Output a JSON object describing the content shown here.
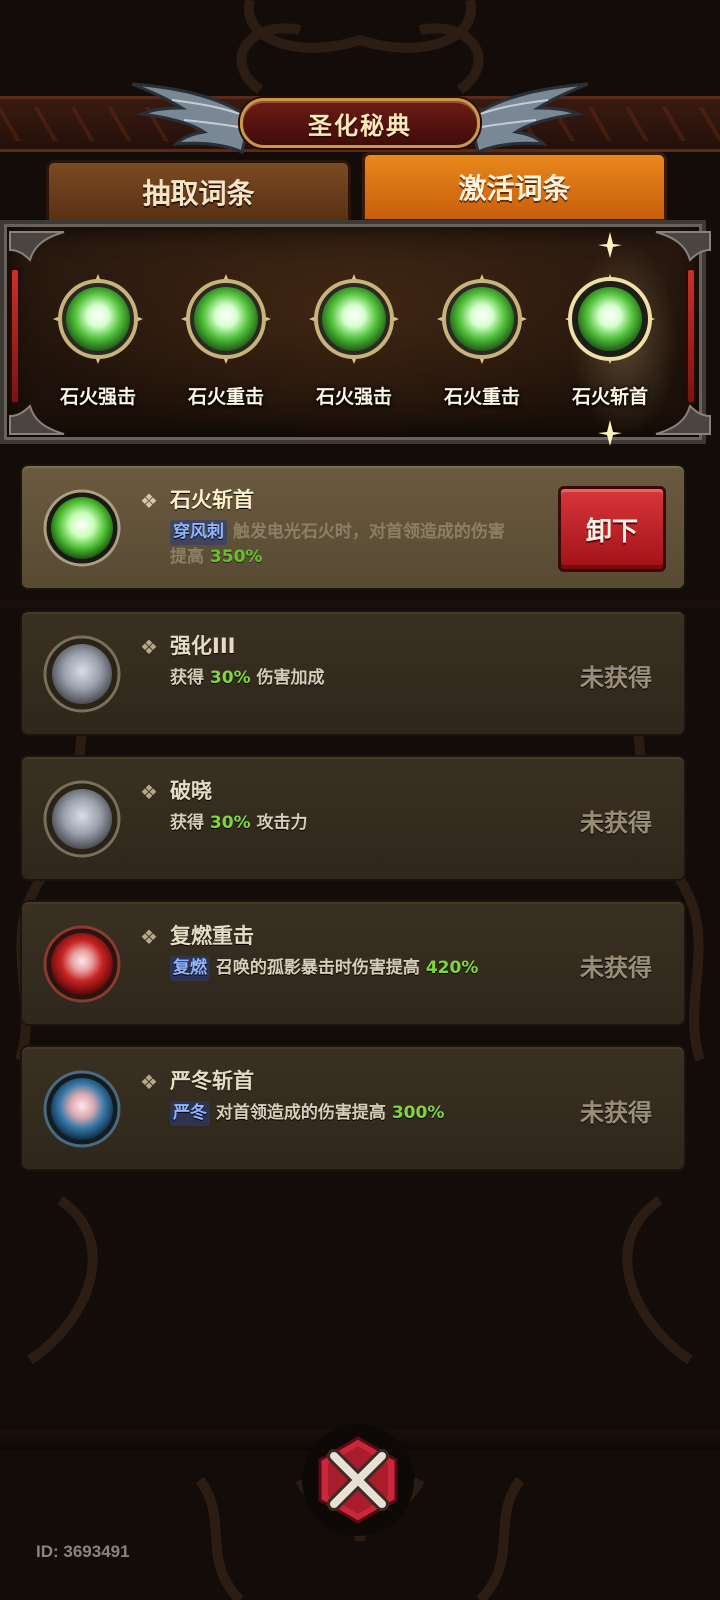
{
  "header": {
    "title": "圣化秘典"
  },
  "tabs": [
    {
      "label": "抽取词条",
      "active": false
    },
    {
      "label": "激活词条",
      "active": true
    }
  ],
  "equipped_slots": [
    {
      "label": "石火强击",
      "orb_color": "green",
      "selected": false
    },
    {
      "label": "石火重击",
      "orb_color": "green",
      "selected": false
    },
    {
      "label": "石火强击",
      "orb_color": "green",
      "selected": false
    },
    {
      "label": "石火重击",
      "orb_color": "green",
      "selected": false
    },
    {
      "label": "石火斩首",
      "orb_color": "green",
      "selected": true
    }
  ],
  "entries": [
    {
      "name": "石火斩首",
      "tag": "穿风刺",
      "desc_before": "触发电光石火时，对首领造成的伤害提高",
      "pct": "350%",
      "desc_after": "",
      "orb_color": "green",
      "active": true,
      "action_label": "卸下"
    },
    {
      "name": "强化III",
      "tag": "",
      "desc_before": "获得",
      "pct": "30%",
      "desc_after": "伤害加成",
      "orb_color": "grey",
      "active": false,
      "status": "未获得"
    },
    {
      "name": "破晓",
      "tag": "",
      "desc_before": "获得",
      "pct": "30%",
      "desc_after": "攻击力",
      "orb_color": "grey",
      "active": false,
      "status": "未获得"
    },
    {
      "name": "复燃重击",
      "tag": "复燃",
      "desc_before": "召唤的孤影暴击时伤害提高",
      "pct": "420%",
      "desc_after": "",
      "orb_color": "red",
      "active": false,
      "status": "未获得"
    },
    {
      "name": "严冬斩首",
      "tag": "严冬",
      "desc_before": "对首领造成的伤害提高",
      "pct": "300%",
      "desc_after": "",
      "orb_color": "blue",
      "active": false,
      "status": "未获得"
    }
  ],
  "footer": {
    "id_text": "ID: 3693491"
  },
  "colors": {
    "accent_orange": "#e8881c",
    "unequip_red": "#c8282c",
    "percent_green": "#7fd640",
    "tag_blue": "#8db4ff"
  }
}
